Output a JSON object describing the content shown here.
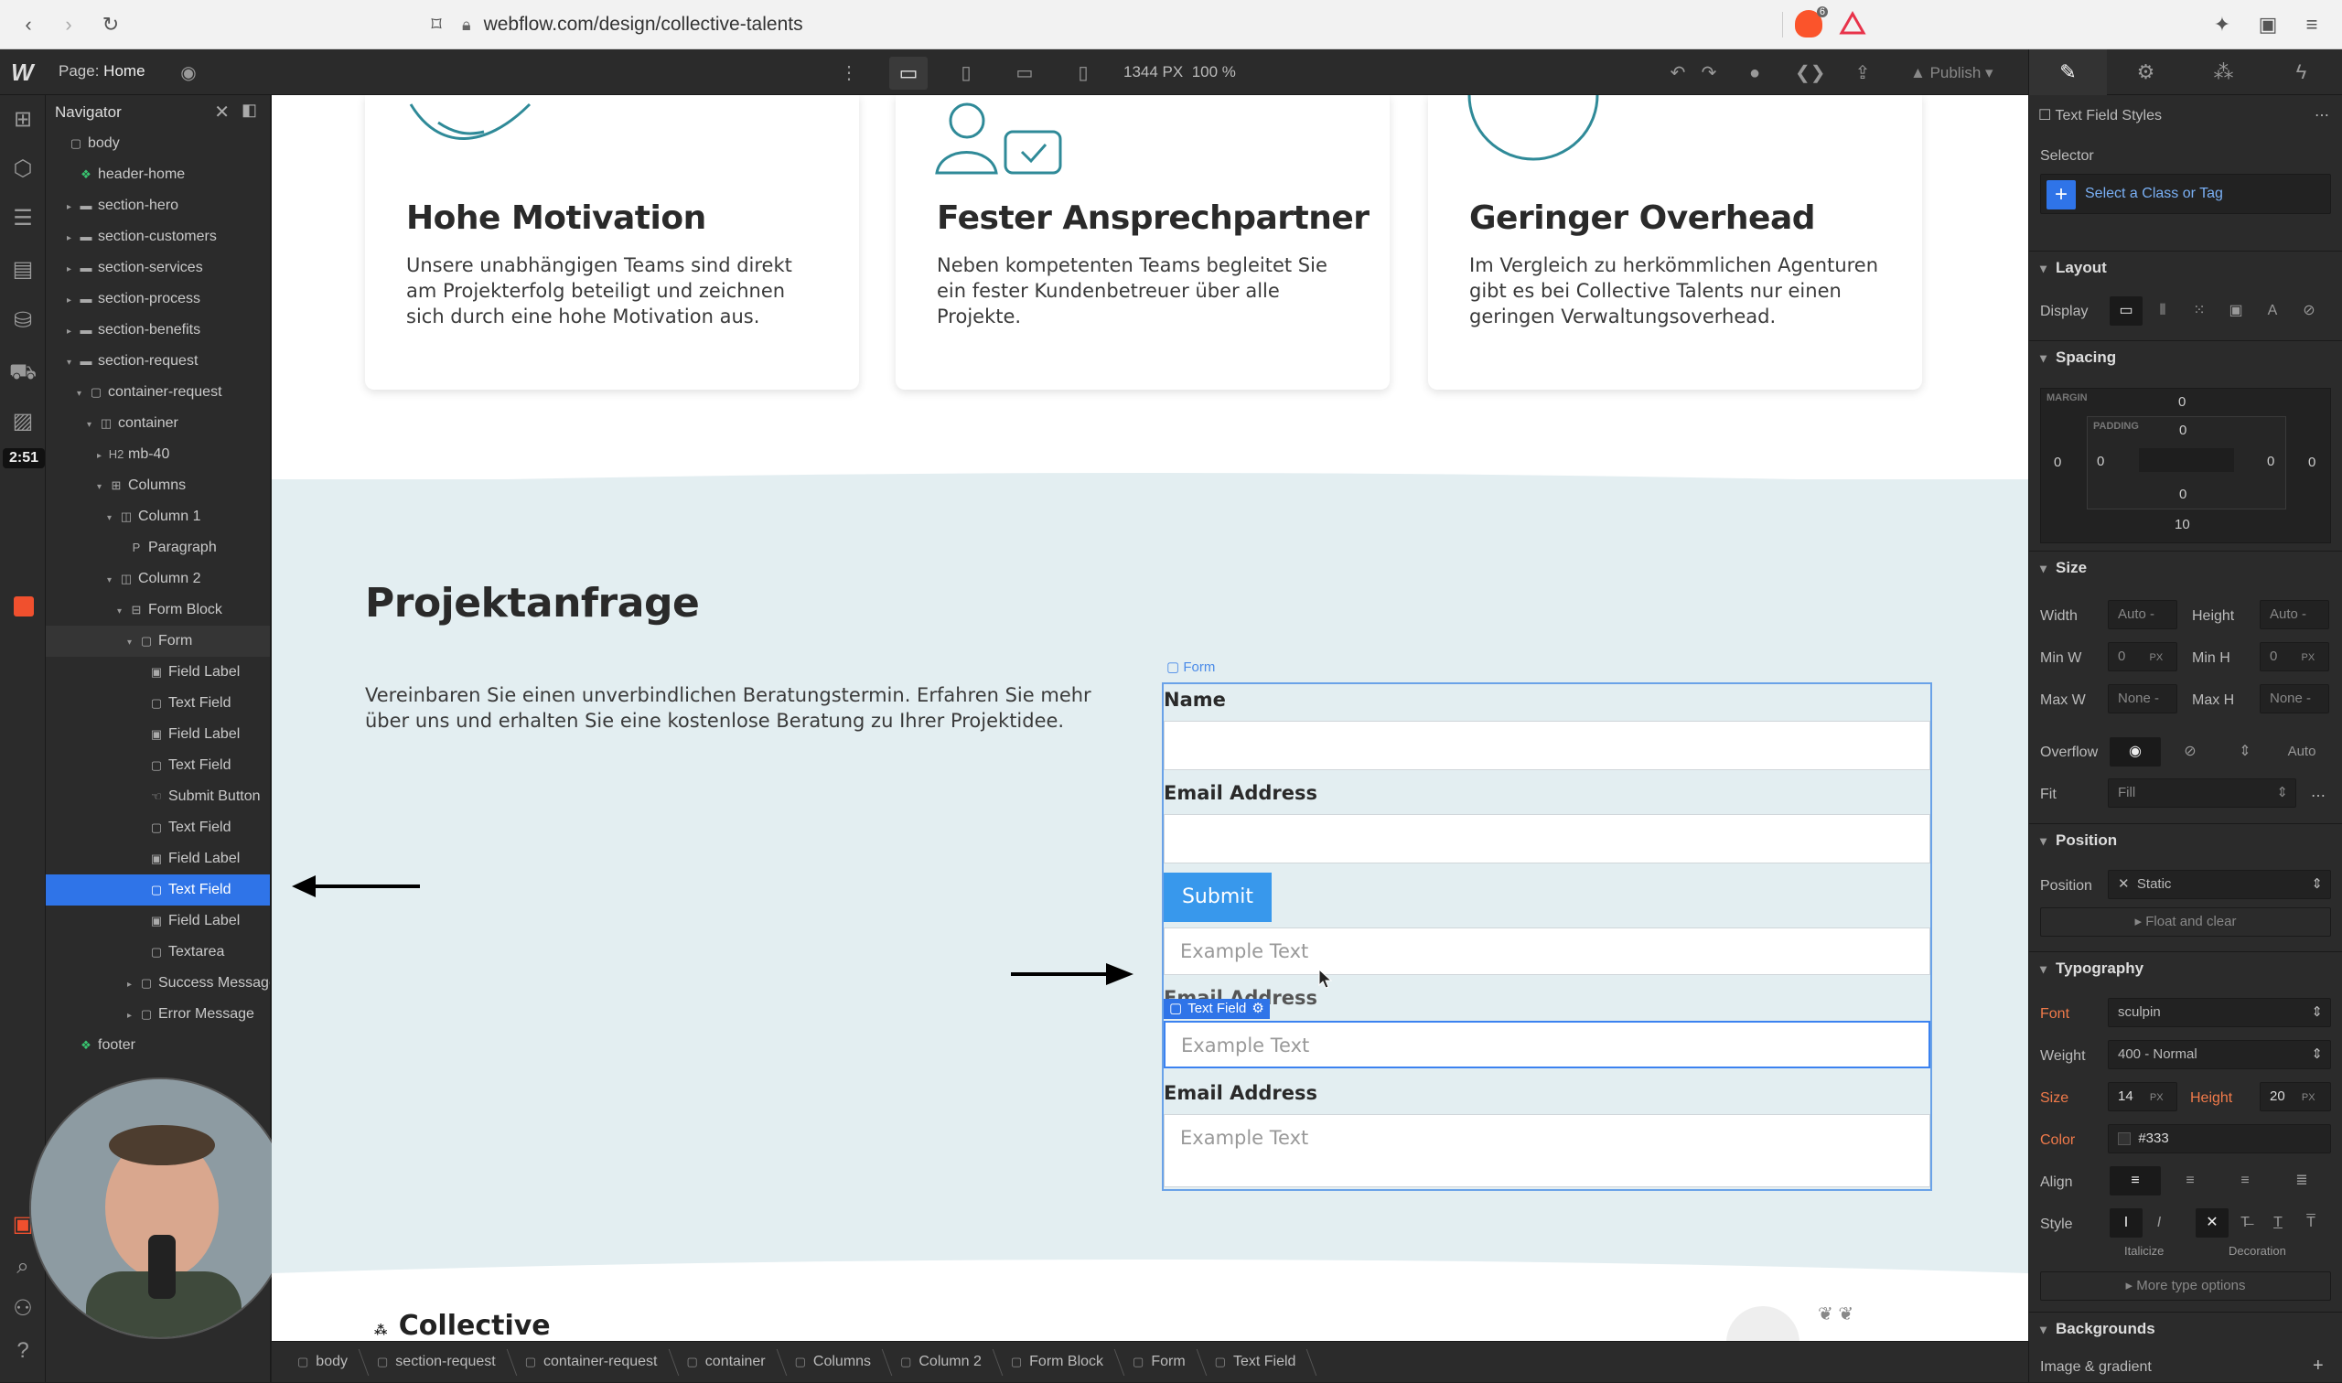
{
  "browser": {
    "url": "webflow.com/design/collective-talents",
    "ext_badge": "6"
  },
  "topbar": {
    "page_prefix": "Page:",
    "page_name": "Home",
    "canvas_width": "1344 PX",
    "zoom": "100 %",
    "publish": "Publish"
  },
  "timer": "2:51",
  "navigator": {
    "title": "Navigator",
    "items": [
      {
        "label": "body",
        "depth": 0,
        "icon": "box"
      },
      {
        "label": "header-home",
        "depth": 1,
        "icon": "symbol"
      },
      {
        "label": "section-hero",
        "depth": 1,
        "icon": "section",
        "caret": "right"
      },
      {
        "label": "section-customers",
        "depth": 1,
        "icon": "section",
        "caret": "right"
      },
      {
        "label": "section-services",
        "depth": 1,
        "icon": "section",
        "caret": "right"
      },
      {
        "label": "section-process",
        "depth": 1,
        "icon": "section",
        "caret": "right"
      },
      {
        "label": "section-benefits",
        "depth": 1,
        "icon": "section",
        "caret": "right"
      },
      {
        "label": "section-request",
        "depth": 1,
        "icon": "section",
        "caret": "down"
      },
      {
        "label": "container-request",
        "depth": 2,
        "icon": "box",
        "caret": "down"
      },
      {
        "label": "container",
        "depth": 3,
        "icon": "container",
        "caret": "down"
      },
      {
        "label": "mb-40",
        "depth": 4,
        "icon": "H2",
        "caret": "right"
      },
      {
        "label": "Columns",
        "depth": 4,
        "icon": "columns",
        "caret": "down"
      },
      {
        "label": "Column 1",
        "depth": 5,
        "icon": "column",
        "caret": "down"
      },
      {
        "label": "Paragraph",
        "depth": 6,
        "icon": "P"
      },
      {
        "label": "Column 2",
        "depth": 5,
        "icon": "column",
        "caret": "down"
      },
      {
        "label": "Form Block",
        "depth": 6,
        "icon": "form",
        "caret": "down"
      },
      {
        "label": "Form",
        "depth": 7,
        "icon": "box",
        "caret": "down",
        "state": "hover"
      },
      {
        "label": "Field Label",
        "depth": 8,
        "icon": "label"
      },
      {
        "label": "Text Field",
        "depth": 8,
        "icon": "box"
      },
      {
        "label": "Field Label",
        "depth": 8,
        "icon": "label"
      },
      {
        "label": "Text Field",
        "depth": 8,
        "icon": "box"
      },
      {
        "label": "Submit Button",
        "depth": 8,
        "icon": "hand"
      },
      {
        "label": "Text Field",
        "depth": 8,
        "icon": "box"
      },
      {
        "label": "Field Label",
        "depth": 8,
        "icon": "label"
      },
      {
        "label": "Text Field",
        "depth": 8,
        "icon": "box",
        "state": "selected"
      },
      {
        "label": "Field Label",
        "depth": 8,
        "icon": "label"
      },
      {
        "label": "Textarea",
        "depth": 8,
        "icon": "box"
      },
      {
        "label": "Success Message",
        "depth": 7,
        "icon": "box",
        "caret": "right"
      },
      {
        "label": "Error Message",
        "depth": 7,
        "icon": "box",
        "caret": "right"
      },
      {
        "label": "footer",
        "depth": 1,
        "icon": "symbol"
      }
    ]
  },
  "cards": [
    {
      "title": "Hohe Motivation",
      "text": "Unsere unabhängigen Teams sind direkt am Projekterfolg beteiligt und zeichnen sich durch eine hohe Motivation aus."
    },
    {
      "title": "Fester Ansprechpartner",
      "text": "Neben kompetenten Teams begleitet Sie ein fester Kundenbetreuer über alle Projekte."
    },
    {
      "title": "Geringer Overhead",
      "text": "Im Vergleich zu herkömmlichen Agenturen gibt es bei Collective Talents nur einen geringen Verwaltungsoverhead."
    }
  ],
  "request": {
    "title": "Projektanfrage",
    "paragraph": "Vereinbaren Sie einen unverbindlichen Beratungstermin. Erfahren Sie mehr über uns und erhalten Sie eine kostenlose Beratung zu Ihrer Projektidee.",
    "form_tag": "Form",
    "label_name": "Name",
    "label_email": "Email Address",
    "submit": "Submit",
    "placeholder": "Example Text",
    "label_email_overlapped": "Email Address",
    "tf_tag": "Text Field",
    "label_email_2": "Email Address"
  },
  "footer_logo": "Collective",
  "breadcrumbs": [
    "body",
    "section-request",
    "container-request",
    "container",
    "Columns",
    "Column 2",
    "Form Block",
    "Form",
    "Text Field"
  ],
  "style_panel": {
    "header": "Text Field Styles",
    "selector_label": "Selector",
    "selector_placeholder": "Select a Class or Tag",
    "layout": "Layout",
    "display": "Display",
    "spacing": "Spacing",
    "margin_lbl": "MARGIN",
    "padding_lbl": "PADDING",
    "margin": {
      "top": "0",
      "right": "0",
      "bottom": "10",
      "left": "0"
    },
    "padding": {
      "top": "0",
      "right": "0",
      "bottom": "0",
      "left": "0"
    },
    "size": "Size",
    "width": "Width",
    "height": "Height",
    "auto": "Auto",
    "dash": "-",
    "min_w": "Min W",
    "min_h": "Min H",
    "zero": "0",
    "px": "PX",
    "max_w": "Max W",
    "max_h": "Max H",
    "none": "None",
    "overflow": "Overflow",
    "overflow_auto": "Auto",
    "fit": "Fit",
    "fit_value": "Fill",
    "position": "Position",
    "position_value": "Static",
    "float_clear": "Float and clear",
    "typography": "Typography",
    "font": "Font",
    "font_value": "sculpin",
    "weight": "Weight",
    "weight_value": "400 - Normal",
    "size_lbl": "Size",
    "size_value": "14",
    "line_height_lbl": "Height",
    "line_height_value": "20",
    "color": "Color",
    "color_value": "#333",
    "align": "Align",
    "style": "Style",
    "italicize": "Italicize",
    "decoration": "Decoration",
    "more_type": "More type options",
    "backgrounds": "Backgrounds",
    "image_gradient": "Image & gradient"
  },
  "colors": {
    "accent": "#2f74e8",
    "submit": "#3898ec",
    "section_bg": "#e3eef1",
    "orange": "#f0502e"
  }
}
